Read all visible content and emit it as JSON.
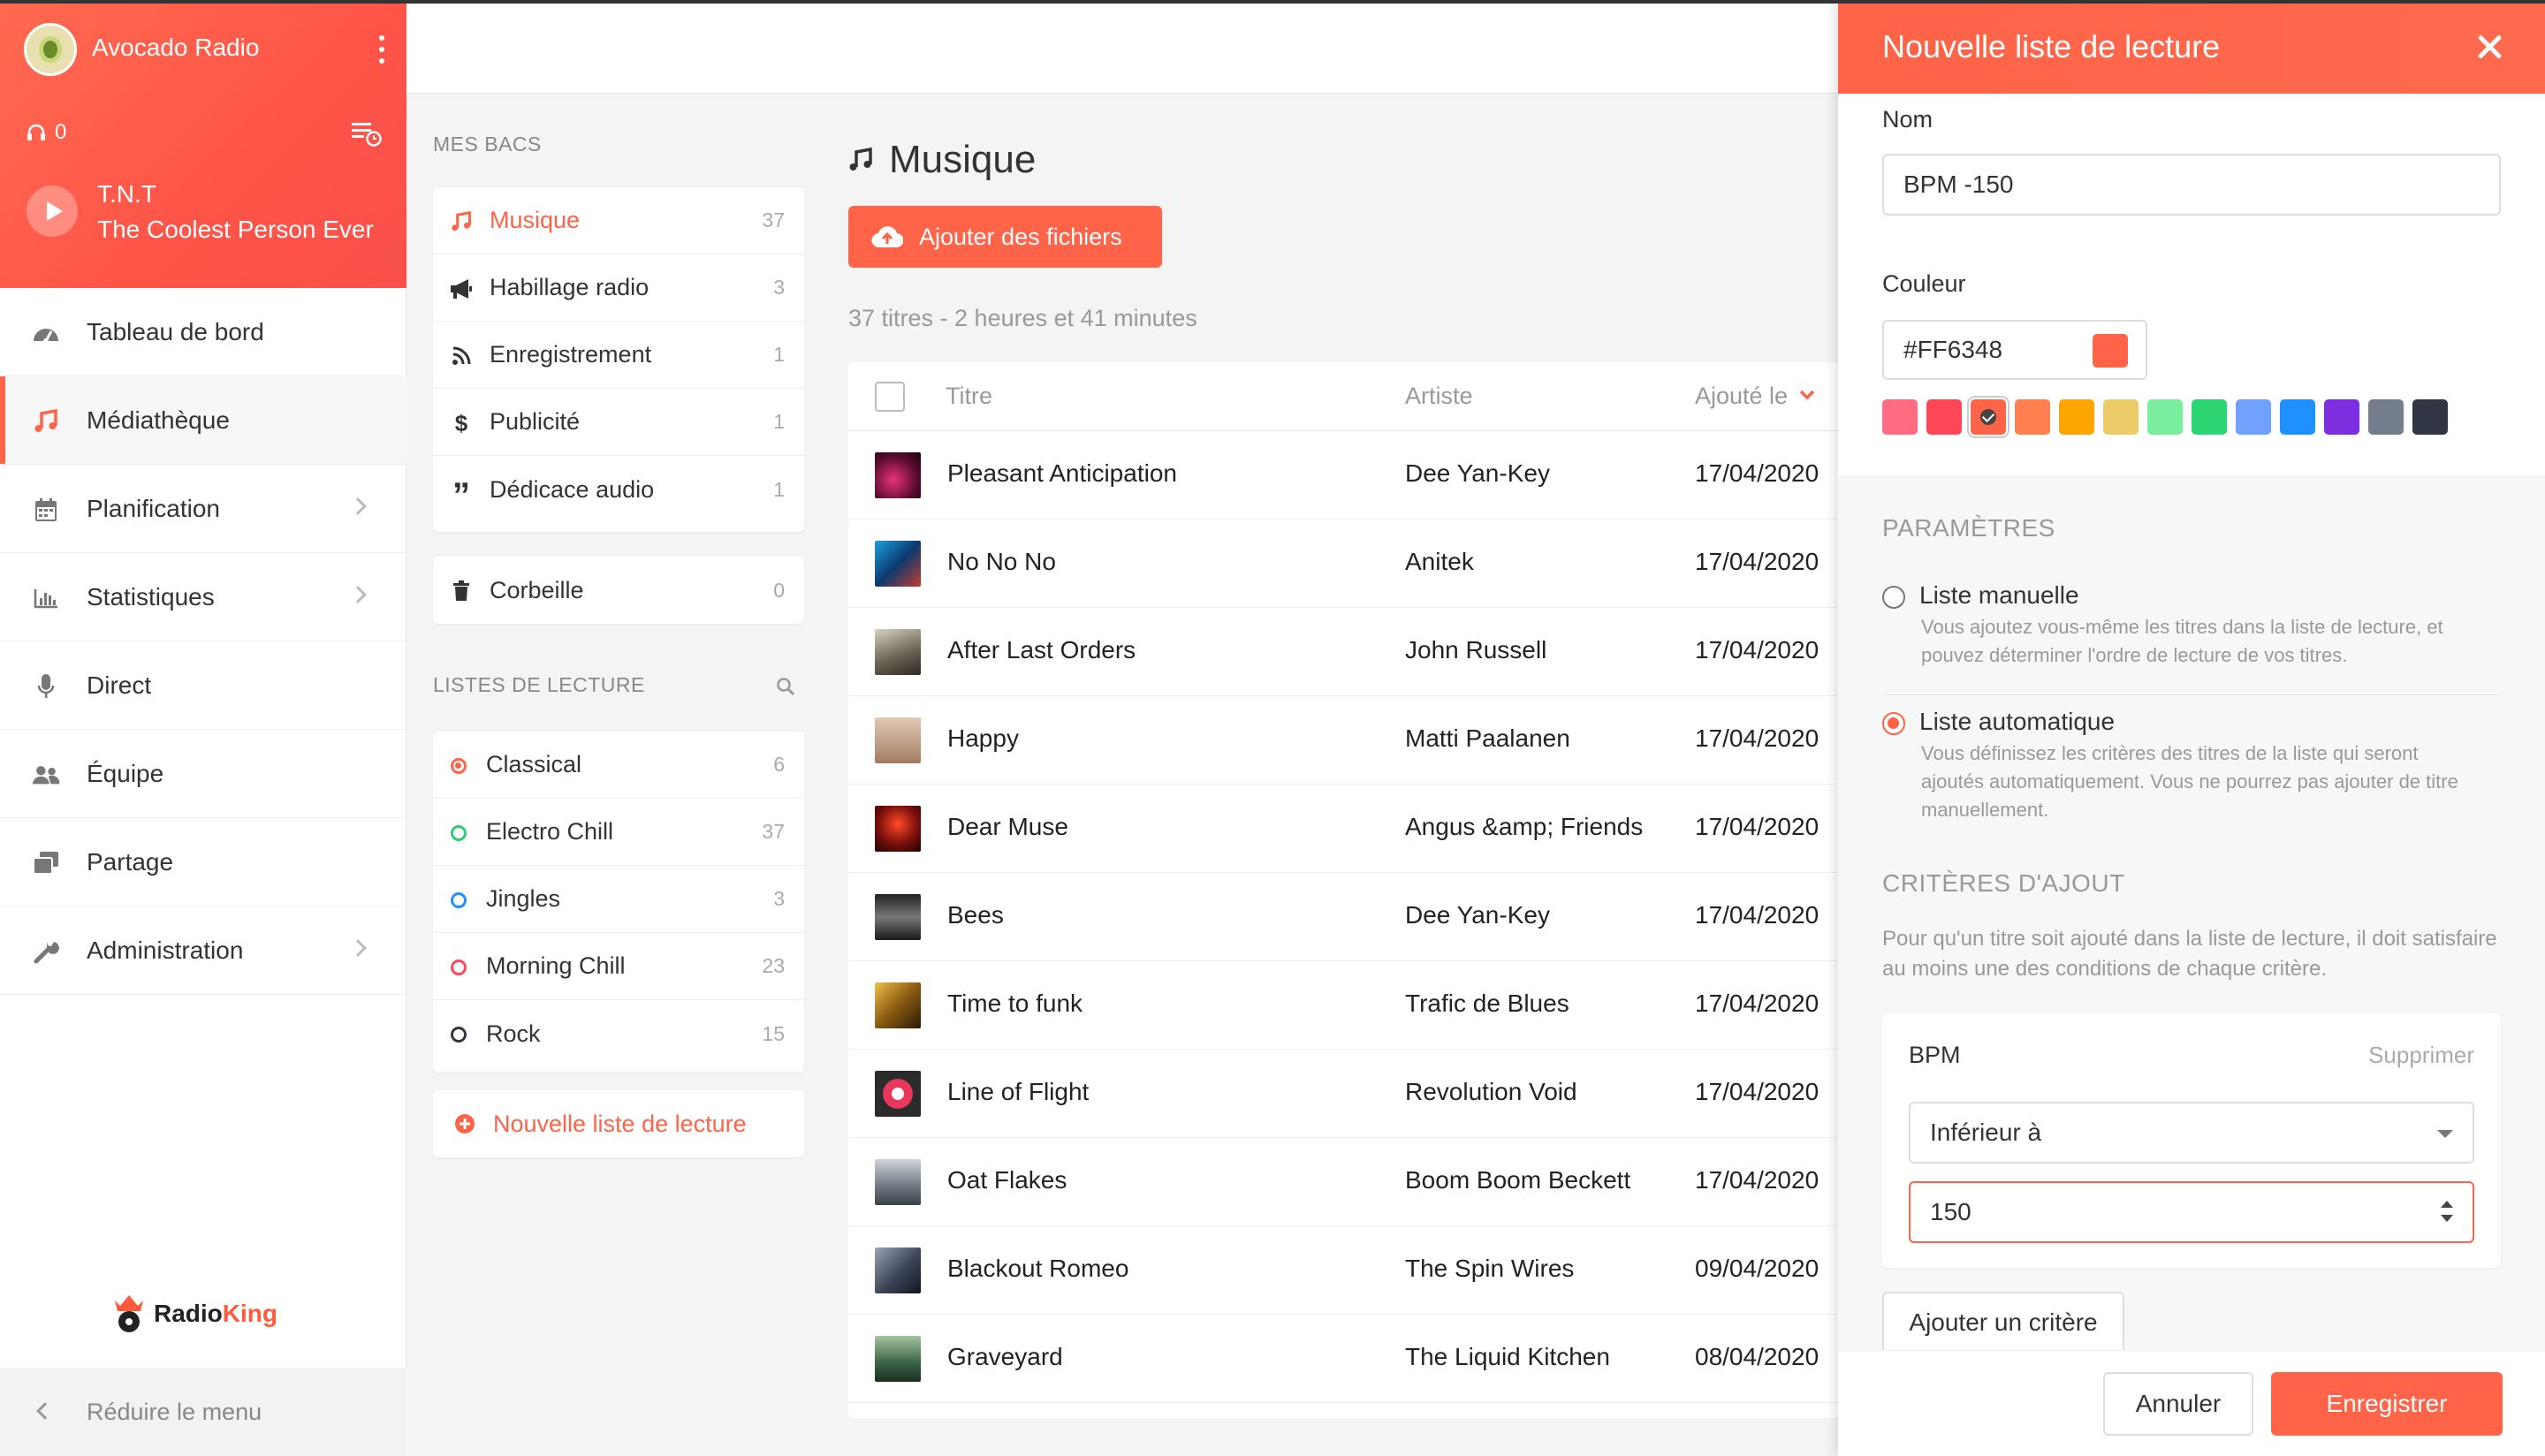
{
  "app": {
    "radio_name": "Avocado Radio",
    "listeners": "0"
  },
  "now_playing": {
    "artist": "T.N.T",
    "title": "The Coolest Person Ever"
  },
  "nav": [
    {
      "label": "Tableau de bord",
      "icon": "dashboard-icon",
      "chevron": false
    },
    {
      "label": "Médiathèque",
      "icon": "music-note-icon",
      "chevron": false,
      "active": true
    },
    {
      "label": "Planification",
      "icon": "calendar-icon",
      "chevron": true
    },
    {
      "label": "Statistiques",
      "icon": "bar-chart-icon",
      "chevron": true
    },
    {
      "label": "Direct",
      "icon": "microphone-icon",
      "chevron": false
    },
    {
      "label": "Équipe",
      "icon": "users-icon",
      "chevron": false
    },
    {
      "label": "Partage",
      "icon": "share-icon",
      "chevron": false
    },
    {
      "label": "Administration",
      "icon": "wrench-icon",
      "chevron": true
    }
  ],
  "brand": {
    "radio": "Radio",
    "king": "King"
  },
  "reduce_label": "Réduire le menu",
  "bins": {
    "title": "MES BACS",
    "items": [
      {
        "label": "Musique",
        "count": "37",
        "icon": "music-note-icon",
        "active": true
      },
      {
        "label": "Habillage radio",
        "count": "3",
        "icon": "megaphone-icon"
      },
      {
        "label": "Enregistrement",
        "count": "1",
        "icon": "rss-icon"
      },
      {
        "label": "Publicité",
        "count": "1",
        "icon": "dollar-icon"
      },
      {
        "label": "Dédicace audio",
        "count": "1",
        "icon": "quote-icon"
      }
    ],
    "trash": {
      "label": "Corbeille",
      "count": "0",
      "icon": "trash-icon"
    }
  },
  "playlists": {
    "title": "LISTES DE LECTURE",
    "items": [
      {
        "label": "Classical",
        "count": "6",
        "color": "#ff6348"
      },
      {
        "label": "Electro Chill",
        "count": "37",
        "color": "#2ecc71"
      },
      {
        "label": "Jingles",
        "count": "3",
        "color": "#1e90ff"
      },
      {
        "label": "Morning Chill",
        "count": "23",
        "color": "#ff4757"
      },
      {
        "label": "Rock",
        "count": "15",
        "color": "#2f3542"
      }
    ],
    "new_label": "Nouvelle liste de lecture"
  },
  "music": {
    "title": "Musique",
    "add_files": "Ajouter des fichiers",
    "summary": "37 titres - 2 heures et 41 minutes",
    "columns": {
      "title": "Titre",
      "artist": "Artiste",
      "added": "Ajouté le"
    },
    "tracks": [
      {
        "title": "Pleasant Anticipation",
        "artist": "Dee Yan-Key",
        "added": "17/04/2020"
      },
      {
        "title": "No No No",
        "artist": "Anitek",
        "added": "17/04/2020"
      },
      {
        "title": "After Last Orders",
        "artist": "John Russell",
        "added": "17/04/2020"
      },
      {
        "title": "Happy",
        "artist": "Matti Paalanen",
        "added": "17/04/2020"
      },
      {
        "title": "Dear Muse",
        "artist": "Angus &amp; Friends",
        "added": "17/04/2020"
      },
      {
        "title": "Bees",
        "artist": "Dee Yan-Key",
        "added": "17/04/2020"
      },
      {
        "title": "Time to funk",
        "artist": "Trafic de Blues",
        "added": "17/04/2020"
      },
      {
        "title": "Line of Flight",
        "artist": "Revolution Void",
        "added": "17/04/2020"
      },
      {
        "title": "Oat Flakes",
        "artist": "Boom Boom Beckett",
        "added": "17/04/2020"
      },
      {
        "title": "Blackout Romeo",
        "artist": "The Spin Wires",
        "added": "09/04/2020"
      },
      {
        "title": "Graveyard",
        "artist": "The Liquid Kitchen",
        "added": "08/04/2020"
      }
    ]
  },
  "panel": {
    "title": "Nouvelle liste de lecture",
    "name_label": "Nom",
    "name_value": "BPM -150",
    "color_label": "Couleur",
    "color_value": "#FF6348",
    "swatches": [
      "#ff6b81",
      "#ff4757",
      "#ff6348",
      "#ff7f50",
      "#ffa502",
      "#eccc68",
      "#7bed9f",
      "#2ed573",
      "#70a1ff",
      "#1e90ff",
      "#7d2fe0",
      "#747d8c",
      "#2f3542"
    ],
    "selected_swatch": 2,
    "params_title": "PARAMÈTRES",
    "manual_label": "Liste manuelle",
    "manual_desc": "Vous ajoutez vous-même les titres dans la liste de lecture, et pouvez déterminer l'ordre de lecture de vos titres.",
    "auto_label": "Liste automatique",
    "auto_desc": "Vous définissez les critères des titres de la liste qui seront ajoutés automatiquement. Vous ne pourrez pas ajouter de titre manuellement.",
    "criteria_title": "CRITÈRES D'AJOUT",
    "criteria_desc": "Pour qu'un titre soit ajouté dans la liste de lecture, il doit satisfaire au moins une des conditions de chaque critère.",
    "criterion": {
      "name": "BPM",
      "delete": "Supprimer",
      "operator": "Inférieur à",
      "value": "150"
    },
    "add_criterion": "Ajouter un critère",
    "cancel": "Annuler",
    "save": "Enregistrer"
  }
}
